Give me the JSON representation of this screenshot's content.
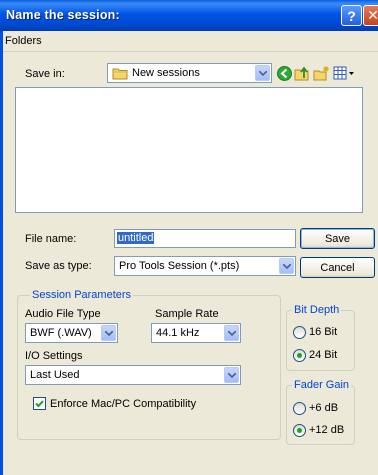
{
  "window": {
    "title": "Name the session:"
  },
  "titlebar": {
    "help_glyph": "?",
    "close_glyph": "✕"
  },
  "menu": {
    "folders": "Folders"
  },
  "save_in": {
    "label": "Save in:",
    "value": "New sessions"
  },
  "file_name": {
    "label": "File name:",
    "value": "untitled"
  },
  "save_as_type": {
    "label": "Save as type:",
    "value": "Pro Tools Session (*.pts)"
  },
  "buttons": {
    "save": "Save",
    "cancel": "Cancel"
  },
  "session_parameters": {
    "title": "Session Parameters",
    "audio_file_type": {
      "label": "Audio File Type",
      "value": "BWF (.WAV)"
    },
    "sample_rate": {
      "label": "Sample Rate",
      "value": "44.1 kHz"
    },
    "io_settings": {
      "label": "I/O Settings",
      "value": "Last Used"
    },
    "enforce": {
      "label": "Enforce Mac/PC Compatibility",
      "checked": true
    }
  },
  "bit_depth": {
    "title": "Bit Depth",
    "options": [
      {
        "label": "16 Bit",
        "selected": false
      },
      {
        "label": "24 Bit",
        "selected": true
      }
    ]
  },
  "fader_gain": {
    "title": "Fader Gain",
    "options": [
      {
        "label": "+6 dB",
        "selected": false
      },
      {
        "label": "+12 dB",
        "selected": true
      }
    ]
  },
  "colors": {
    "titlebar": "#0055e5",
    "group_title": "#0046d5",
    "dialog_bg": "#ece9d8"
  },
  "icons": [
    "folder-icon",
    "back-icon",
    "up-folder-icon",
    "new-folder-icon",
    "view-menu-icon",
    "chevron-down-icon"
  ]
}
